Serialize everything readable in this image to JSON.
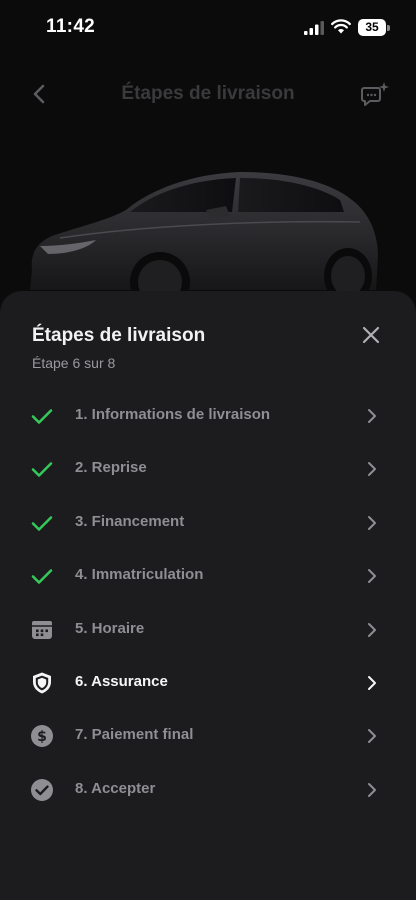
{
  "status_bar": {
    "time": "11:42",
    "battery": "35",
    "icons": [
      "signal-icon",
      "wifi-icon",
      "battery-icon"
    ]
  },
  "header": {
    "title": "Étapes de livraison",
    "back_icon": "chevron-left-icon",
    "chat_icon": "chat-sparkle-icon"
  },
  "sheet": {
    "title": "Étapes de livraison",
    "subtitle": "Étape 6 sur 8",
    "close_icon": "close-icon",
    "steps": [
      {
        "label": "1. Informations de livraison",
        "icon": "check-icon",
        "status": "done"
      },
      {
        "label": "2. Reprise",
        "icon": "check-icon",
        "status": "done"
      },
      {
        "label": "3. Financement",
        "icon": "check-icon",
        "status": "done"
      },
      {
        "label": "4. Immatriculation",
        "icon": "check-icon",
        "status": "done"
      },
      {
        "label": "5. Horaire",
        "icon": "calendar-icon",
        "status": "pending"
      },
      {
        "label": "6. Assurance",
        "icon": "shield-icon",
        "status": "current"
      },
      {
        "label": "7. Paiement final",
        "icon": "dollar-icon",
        "status": "pending"
      },
      {
        "label": "8. Accepter",
        "icon": "check-circle-icon",
        "status": "pending"
      }
    ]
  },
  "colors": {
    "background": "#0b0b0c",
    "sheet": "#1c1c1e",
    "check_green": "#34c759",
    "muted_text": "#8e8e93",
    "active_text": "#f5f5f5"
  }
}
